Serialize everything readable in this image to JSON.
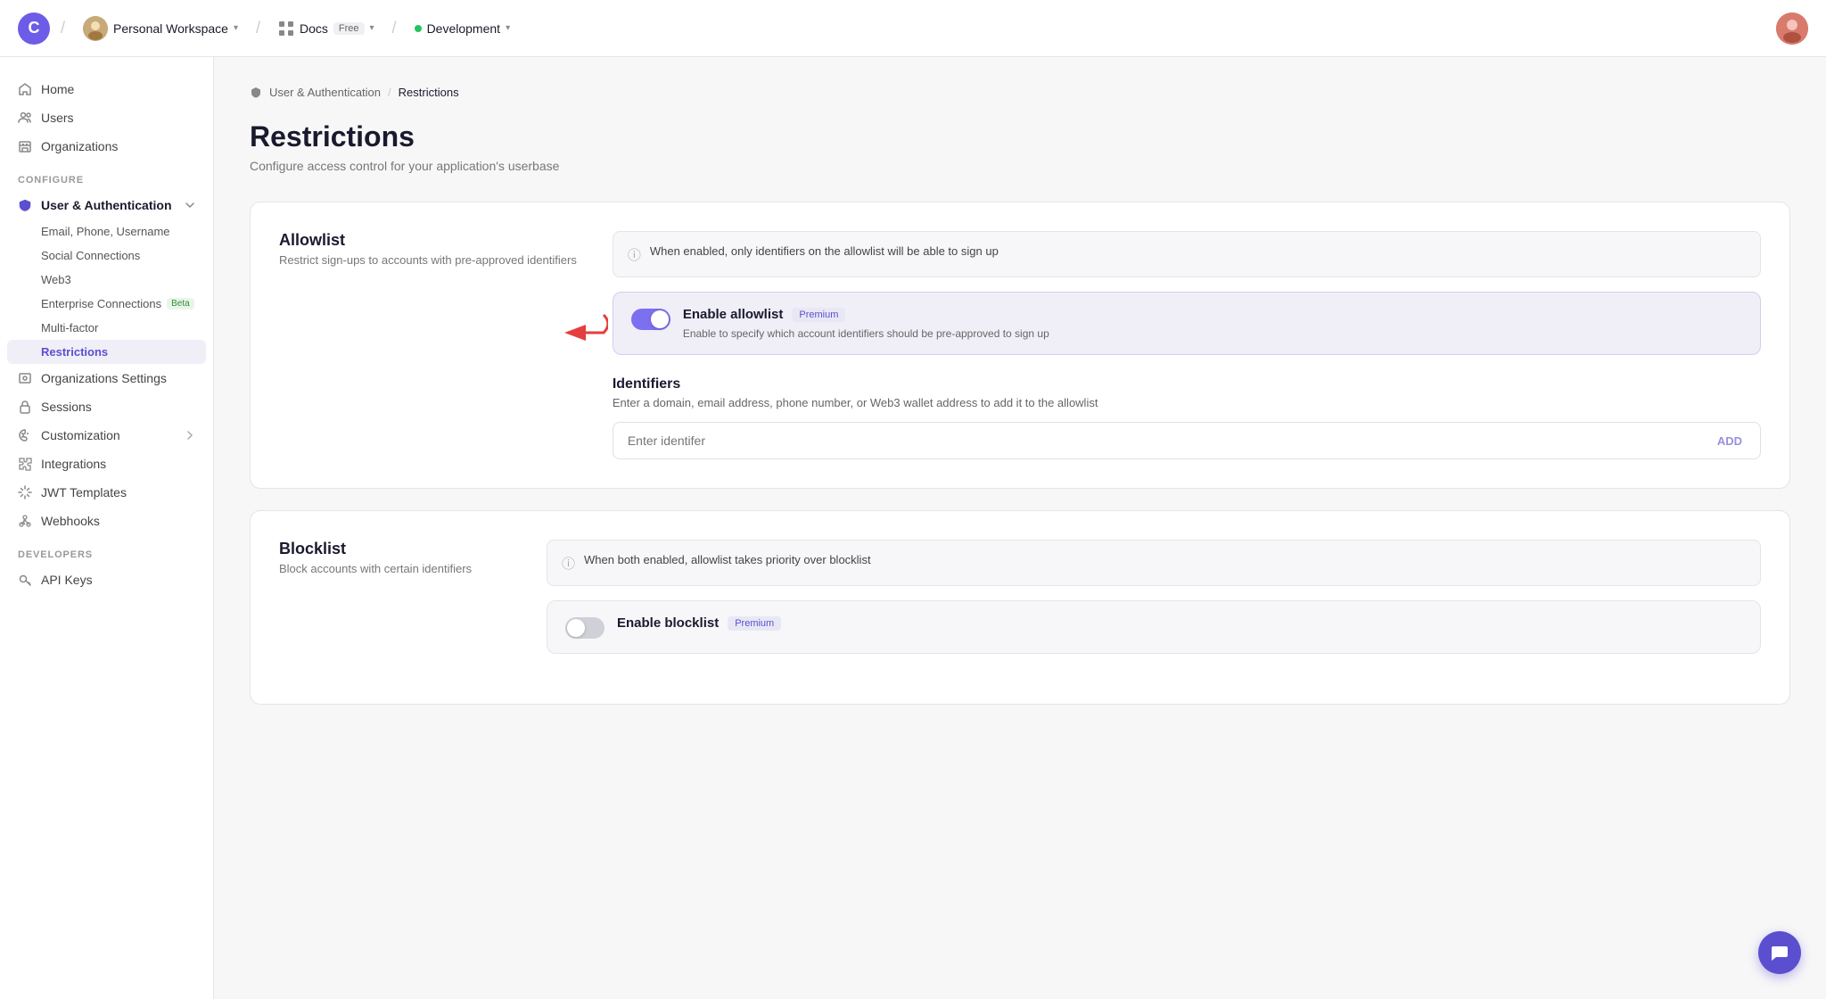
{
  "topnav": {
    "logo_alt": "Clerk logo",
    "workspace_label": "Personal Workspace",
    "app_name": "Docs",
    "app_badge": "Free",
    "env_label": "Development",
    "caret": "▾"
  },
  "sidebar": {
    "nav_items": [
      {
        "id": "home",
        "label": "Home",
        "icon": "home"
      },
      {
        "id": "users",
        "label": "Users",
        "icon": "users"
      },
      {
        "id": "organizations",
        "label": "Organizations",
        "icon": "building"
      }
    ],
    "configure_label": "CONFIGURE",
    "user_auth": {
      "label": "User & Authentication",
      "icon": "shield",
      "expanded": true,
      "children": [
        {
          "id": "email-phone",
          "label": "Email, Phone, Username"
        },
        {
          "id": "social",
          "label": "Social Connections"
        },
        {
          "id": "web3",
          "label": "Web3"
        },
        {
          "id": "enterprise",
          "label": "Enterprise Connections",
          "badge": "Beta"
        },
        {
          "id": "mfa",
          "label": "Multi-factor"
        },
        {
          "id": "restrictions",
          "label": "Restrictions",
          "active": true
        }
      ]
    },
    "extra_items": [
      {
        "id": "org-settings",
        "label": "Organizations Settings",
        "icon": "building"
      },
      {
        "id": "sessions",
        "label": "Sessions",
        "icon": "lock"
      },
      {
        "id": "customization",
        "label": "Customization",
        "icon": "palette",
        "has_arrow": true
      },
      {
        "id": "integrations",
        "label": "Integrations",
        "icon": "puzzle"
      },
      {
        "id": "jwt",
        "label": "JWT Templates",
        "icon": "sparkle"
      },
      {
        "id": "webhooks",
        "label": "Webhooks",
        "icon": "webhook"
      }
    ],
    "developers_label": "DEVELOPERS",
    "dev_items": [
      {
        "id": "api-keys",
        "label": "API Keys",
        "icon": "key"
      }
    ]
  },
  "breadcrumb": {
    "parent": "User & Authentication",
    "current": "Restrictions"
  },
  "page": {
    "title": "Restrictions",
    "subtitle": "Configure access control for your application's userbase"
  },
  "allowlist": {
    "title": "Allowlist",
    "description": "Restrict sign-ups to accounts with pre-approved identifiers",
    "info_text": "When enabled, only identifiers on the allowlist will be able to sign up",
    "toggle_label": "Enable allowlist",
    "toggle_badge": "Premium",
    "toggle_desc": "Enable to specify which account identifiers should be pre-approved to sign up",
    "toggle_state": "on",
    "identifiers_title": "Identifiers",
    "identifiers_desc": "Enter a domain, email address, phone number, or Web3 wallet address to add it to the allowlist",
    "input_placeholder": "Enter identifer",
    "add_btn": "ADD"
  },
  "blocklist": {
    "title": "Blocklist",
    "description": "Block accounts with certain identifiers",
    "info_text": "When both enabled, allowlist takes priority over blocklist",
    "toggle_label": "Enable blocklist",
    "toggle_badge": "Premium",
    "toggle_state": "off"
  },
  "chat_fab_icon": "💬"
}
